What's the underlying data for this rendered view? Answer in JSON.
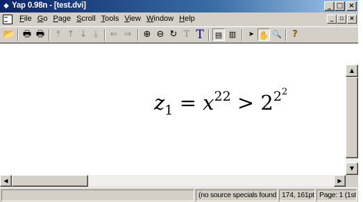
{
  "window": {
    "title": "Yap 0.98n - [test.dvi]",
    "caption_buttons": [
      "_",
      "□",
      "×"
    ]
  },
  "menu": {
    "items": [
      {
        "underline": "F",
        "rest": "ile"
      },
      {
        "underline": "G",
        "rest": "o"
      },
      {
        "underline": "P",
        "rest": "age"
      },
      {
        "underline": "S",
        "rest": "croll"
      },
      {
        "underline": "T",
        "rest": "ools"
      },
      {
        "underline": "V",
        "rest": "iew"
      },
      {
        "underline": "W",
        "rest": "indow"
      },
      {
        "underline": "H",
        "rest": "elp"
      }
    ],
    "mdi_buttons": [
      "_",
      "▫",
      "×"
    ]
  },
  "toolbar": {
    "buttons": [
      {
        "icon": "open-folder-icon",
        "glyph": "📂",
        "enabled": true
      },
      {
        "icon": "print-icon",
        "glyph": "🖶",
        "enabled": true
      },
      {
        "icon": "print-setup-icon",
        "glyph": "🖶",
        "enabled": true
      },
      {
        "icon": "first-page-icon",
        "glyph": "⤒",
        "enabled": false
      },
      {
        "icon": "previous-page-icon",
        "glyph": "↑",
        "enabled": false
      },
      {
        "icon": "next-page-icon",
        "glyph": "↓",
        "enabled": false
      },
      {
        "icon": "last-page-icon",
        "glyph": "⤓",
        "enabled": false
      },
      {
        "icon": "back-icon",
        "glyph": "⇐",
        "enabled": false
      },
      {
        "icon": "forward-icon",
        "glyph": "⇒",
        "enabled": false
      },
      {
        "icon": "zoom-in-icon",
        "glyph": "⊕",
        "enabled": true
      },
      {
        "icon": "zoom-out-icon",
        "glyph": "⊖",
        "enabled": true
      },
      {
        "icon": "refresh-icon",
        "glyph": "↻",
        "enabled": true
      },
      {
        "icon": "font-small-icon",
        "glyph": "T",
        "enabled": false
      },
      {
        "icon": "font-large-icon",
        "glyph": "T",
        "enabled": true
      },
      {
        "icon": "single-page-icon",
        "glyph": "▤",
        "enabled": true
      },
      {
        "icon": "double-page-icon",
        "glyph": "▥",
        "enabled": true
      },
      {
        "icon": "arrow-pointer-icon",
        "glyph": "➤",
        "enabled": true
      },
      {
        "icon": "hand-tool-icon",
        "glyph": "✋",
        "enabled": true
      },
      {
        "icon": "magnifier-icon",
        "glyph": "🔍",
        "enabled": true
      },
      {
        "icon": "help-icon",
        "glyph": "?",
        "enabled": true
      }
    ]
  },
  "document": {
    "formula": {
      "lhs_var": "z",
      "lhs_sub": "1",
      "eq": "=",
      "x_var": "x",
      "x_sup": "22",
      "gt": ">",
      "base": "2",
      "exp_base": "2",
      "exp_exp": "2"
    }
  },
  "status": {
    "source_specials": "(no source specials found)",
    "coordinates": "174, 161pt",
    "page": "Page: 1 (1st"
  },
  "colors": {
    "title_start": "#0a246a",
    "title_end": "#a6caf0",
    "face": "#d4d0c8"
  }
}
